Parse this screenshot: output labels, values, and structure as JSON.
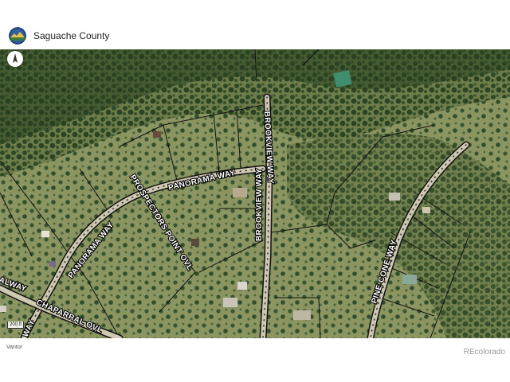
{
  "header": {
    "title": "Saguache County",
    "logo_icon": "county-seal-icon"
  },
  "map": {
    "compass_icon": "north-arrow-icon",
    "scale_label": "200 ft",
    "roads": [
      {
        "label": "PANORAMA WAY"
      },
      {
        "label": "PANORAMA WAY"
      },
      {
        "label": "PROSPECTORS POINT OVL"
      },
      {
        "label": "BROOKVIEW WAY"
      },
      {
        "label": "BROOKVIEW WAY"
      },
      {
        "label": "PINE CONE WAY"
      },
      {
        "label": "CHAPARRAL OVL"
      },
      {
        "label": "ALWAY"
      },
      {
        "label": "WAY"
      }
    ]
  },
  "footer": {
    "attribution": "Vantor",
    "brand": "REcolorado"
  },
  "colors": {
    "forest_dark": "#25401f",
    "clearing": "#7d8a5a",
    "road_fill": "#c9c3b0",
    "parcel_line": "#111111"
  }
}
